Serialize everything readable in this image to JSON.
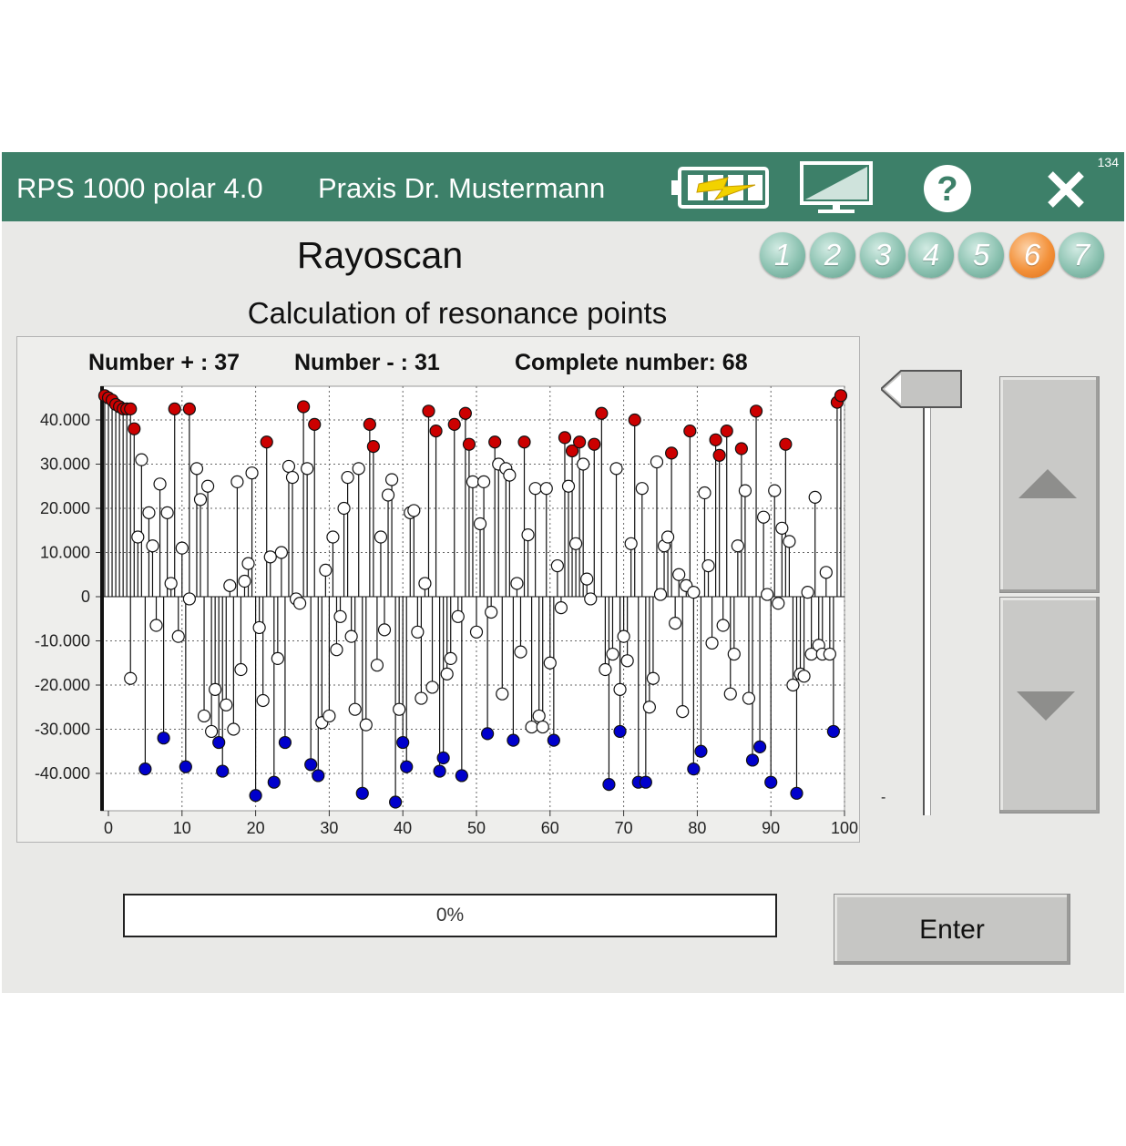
{
  "titlebar": {
    "app_name": "RPS 1000 polar 4.0",
    "practice": "Praxis Dr. Mustermann",
    "corner_number": "134",
    "color": "#3d8069",
    "icons": [
      "battery-charging-icon",
      "display-icon",
      "help-icon",
      "close-icon"
    ]
  },
  "page": {
    "title": "Rayoscan",
    "subtitle": "Calculation of resonance points"
  },
  "steps": {
    "items": [
      "1",
      "2",
      "3",
      "4",
      "5",
      "6",
      "7"
    ],
    "active": "6",
    "active_color": "#f3913a",
    "inactive_color": "#8cc2b1"
  },
  "stats": {
    "plus": "Number + : 37",
    "minus": "Number - : 31",
    "total": "Complete number: 68"
  },
  "slider": {
    "min_label": "-"
  },
  "progress": {
    "value": 0,
    "label": "0%"
  },
  "enter_button": {
    "label": "Enter"
  },
  "chart_data": {
    "type": "scatter",
    "style": "stem",
    "xlim": [
      0,
      100
    ],
    "ylim": [
      -50000,
      50000
    ],
    "x_ticks": [
      "0",
      "10",
      "20",
      "30",
      "40",
      "50",
      "60",
      "70",
      "80",
      "90",
      "100"
    ],
    "y_ticks": [
      "40.000",
      "30.000",
      "20.000",
      "10.000",
      "0",
      "-10.000",
      "-20.000",
      "-30.000",
      "-40.000"
    ],
    "y_tick_values": [
      40000,
      30000,
      20000,
      10000,
      0,
      -10000,
      -20000,
      -30000,
      -40000
    ],
    "grid": true,
    "colors": {
      "positive": "#cc0000",
      "neutral": "#ffffff",
      "negative": "#0000cc"
    },
    "series": [
      {
        "values": [
          [
            -0.5,
            45500,
            "pos"
          ],
          [
            0,
            45000,
            "pos"
          ],
          [
            0.5,
            44500,
            "pos"
          ],
          [
            1,
            43500,
            "pos"
          ],
          [
            1.5,
            43000,
            "pos"
          ],
          [
            2,
            42500,
            "pos"
          ],
          [
            2.5,
            42500,
            "pos"
          ],
          [
            3,
            42500,
            "pos"
          ],
          [
            3.5,
            38000,
            "pos"
          ],
          [
            9,
            42500,
            "pos"
          ],
          [
            11,
            42500,
            "pos"
          ],
          [
            21.5,
            35000,
            "pos"
          ],
          [
            26.5,
            43000,
            "pos"
          ],
          [
            28,
            39000,
            "pos"
          ],
          [
            35.5,
            39000,
            "pos"
          ],
          [
            36,
            34000,
            "pos"
          ],
          [
            43.5,
            42000,
            "pos"
          ],
          [
            44.5,
            37500,
            "pos"
          ],
          [
            47,
            39000,
            "pos"
          ],
          [
            48.5,
            41500,
            "pos"
          ],
          [
            49,
            34500,
            "pos"
          ],
          [
            52.5,
            35000,
            "pos"
          ],
          [
            56.5,
            35000,
            "pos"
          ],
          [
            62,
            36000,
            "pos"
          ],
          [
            63,
            33000,
            "pos"
          ],
          [
            64,
            35000,
            "pos"
          ],
          [
            66,
            34500,
            "pos"
          ],
          [
            67,
            41500,
            "pos"
          ],
          [
            71.5,
            40000,
            "pos"
          ],
          [
            76.5,
            32500,
            "pos"
          ],
          [
            79,
            37500,
            "pos"
          ],
          [
            82.5,
            35500,
            "pos"
          ],
          [
            83,
            32000,
            "pos"
          ],
          [
            84,
            37500,
            "pos"
          ],
          [
            86,
            33500,
            "pos"
          ],
          [
            88,
            42000,
            "pos"
          ],
          [
            92,
            34500,
            "pos"
          ],
          [
            99,
            44000,
            "pos"
          ],
          [
            99.5,
            45500,
            "pos"
          ],
          [
            5,
            -39000,
            "neg"
          ],
          [
            7.5,
            -32000,
            "neg"
          ],
          [
            10.5,
            -38500,
            "neg"
          ],
          [
            15,
            -33000,
            "neg"
          ],
          [
            15.5,
            -39500,
            "neg"
          ],
          [
            20,
            -45000,
            "neg"
          ],
          [
            22.5,
            -42000,
            "neg"
          ],
          [
            24,
            -33000,
            "neg"
          ],
          [
            27.5,
            -38000,
            "neg"
          ],
          [
            28.5,
            -40500,
            "neg"
          ],
          [
            34.5,
            -44500,
            "neg"
          ],
          [
            39,
            -46500,
            "neg"
          ],
          [
            40,
            -33000,
            "neg"
          ],
          [
            40.5,
            -38500,
            "neg"
          ],
          [
            45,
            -39500,
            "neg"
          ],
          [
            45.5,
            -36500,
            "neg"
          ],
          [
            48,
            -40500,
            "neg"
          ],
          [
            51.5,
            -31000,
            "neg"
          ],
          [
            55,
            -32500,
            "neg"
          ],
          [
            60.5,
            -32500,
            "neg"
          ],
          [
            68,
            -42500,
            "neg"
          ],
          [
            69.5,
            -30500,
            "neg"
          ],
          [
            72,
            -42000,
            "neg"
          ],
          [
            73,
            -42000,
            "neg"
          ],
          [
            79.5,
            -39000,
            "neg"
          ],
          [
            80.5,
            -35000,
            "neg"
          ],
          [
            87.5,
            -37000,
            "neg"
          ],
          [
            88.5,
            -34000,
            "neg"
          ],
          [
            90,
            -42000,
            "neg"
          ],
          [
            93.5,
            -44500,
            "neg"
          ],
          [
            98.5,
            -30500,
            "neg"
          ],
          [
            3,
            -18500,
            "neu"
          ],
          [
            4,
            13500,
            "neu"
          ],
          [
            4.5,
            31000,
            "neu"
          ],
          [
            5.5,
            19000,
            "neu"
          ],
          [
            6,
            11500,
            "neu"
          ],
          [
            6.5,
            -6500,
            "neu"
          ],
          [
            7,
            25500,
            "neu"
          ],
          [
            8,
            19000,
            "neu"
          ],
          [
            8.5,
            3000,
            "neu"
          ],
          [
            9.5,
            -9000,
            "neu"
          ],
          [
            10,
            11000,
            "neu"
          ],
          [
            11,
            -500,
            "neu"
          ],
          [
            12,
            29000,
            "neu"
          ],
          [
            12.5,
            22000,
            "neu"
          ],
          [
            13,
            -27000,
            "neu"
          ],
          [
            13.5,
            25000,
            "neu"
          ],
          [
            14,
            -30500,
            "neu"
          ],
          [
            14.5,
            -21000,
            "neu"
          ],
          [
            16,
            -24500,
            "neu"
          ],
          [
            16.5,
            2500,
            "neu"
          ],
          [
            17,
            -30000,
            "neu"
          ],
          [
            17.5,
            26000,
            "neu"
          ],
          [
            18,
            -16500,
            "neu"
          ],
          [
            18.5,
            3500,
            "neu"
          ],
          [
            19,
            7500,
            "neu"
          ],
          [
            19.5,
            28000,
            "neu"
          ],
          [
            20.5,
            -7000,
            "neu"
          ],
          [
            21,
            -23500,
            "neu"
          ],
          [
            22,
            9000,
            "neu"
          ],
          [
            23,
            -14000,
            "neu"
          ],
          [
            23.5,
            10000,
            "neu"
          ],
          [
            24.5,
            29500,
            "neu"
          ],
          [
            25,
            27000,
            "neu"
          ],
          [
            25.5,
            -500,
            "neu"
          ],
          [
            26,
            -1500,
            "neu"
          ],
          [
            27,
            29000,
            "neu"
          ],
          [
            29,
            -28500,
            "neu"
          ],
          [
            29.5,
            6000,
            "neu"
          ],
          [
            30,
            -27000,
            "neu"
          ],
          [
            30.5,
            13500,
            "neu"
          ],
          [
            31,
            -12000,
            "neu"
          ],
          [
            31.5,
            -4500,
            "neu"
          ],
          [
            32,
            20000,
            "neu"
          ],
          [
            32.5,
            27000,
            "neu"
          ],
          [
            33,
            -9000,
            "neu"
          ],
          [
            33.5,
            -25500,
            "neu"
          ],
          [
            34,
            29000,
            "neu"
          ],
          [
            35,
            -29000,
            "neu"
          ],
          [
            36.5,
            -15500,
            "neu"
          ],
          [
            37,
            13500,
            "neu"
          ],
          [
            37.5,
            -7500,
            "neu"
          ],
          [
            38,
            23000,
            "neu"
          ],
          [
            38.5,
            26500,
            "neu"
          ],
          [
            39.5,
            -25500,
            "neu"
          ],
          [
            41,
            19000,
            "neu"
          ],
          [
            41.5,
            19500,
            "neu"
          ],
          [
            42,
            -8000,
            "neu"
          ],
          [
            42.5,
            -23000,
            "neu"
          ],
          [
            43,
            3000,
            "neu"
          ],
          [
            44,
            -20500,
            "neu"
          ],
          [
            46,
            -17500,
            "neu"
          ],
          [
            46.5,
            -14000,
            "neu"
          ],
          [
            47.5,
            -4500,
            "neu"
          ],
          [
            49.5,
            26000,
            "neu"
          ],
          [
            50,
            -8000,
            "neu"
          ],
          [
            50.5,
            16500,
            "neu"
          ],
          [
            51,
            26000,
            "neu"
          ],
          [
            52,
            -3500,
            "neu"
          ],
          [
            53,
            30000,
            "neu"
          ],
          [
            53.5,
            -22000,
            "neu"
          ],
          [
            54,
            29000,
            "neu"
          ],
          [
            54.5,
            27500,
            "neu"
          ],
          [
            55.5,
            3000,
            "neu"
          ],
          [
            56,
            -12500,
            "neu"
          ],
          [
            57,
            14000,
            "neu"
          ],
          [
            57.5,
            -29500,
            "neu"
          ],
          [
            58,
            24500,
            "neu"
          ],
          [
            58.5,
            -27000,
            "neu"
          ],
          [
            59,
            -29500,
            "neu"
          ],
          [
            59.5,
            24500,
            "neu"
          ],
          [
            60,
            -15000,
            "neu"
          ],
          [
            61,
            7000,
            "neu"
          ],
          [
            61.5,
            -2500,
            "neu"
          ],
          [
            62.5,
            25000,
            "neu"
          ],
          [
            63.5,
            12000,
            "neu"
          ],
          [
            64.5,
            30000,
            "neu"
          ],
          [
            65,
            4000,
            "neu"
          ],
          [
            65.5,
            -500,
            "neu"
          ],
          [
            67.5,
            -16500,
            "neu"
          ],
          [
            68.5,
            -13000,
            "neu"
          ],
          [
            69,
            29000,
            "neu"
          ],
          [
            69.5,
            -21000,
            "neu"
          ],
          [
            70,
            -9000,
            "neu"
          ],
          [
            70.5,
            -14500,
            "neu"
          ],
          [
            71,
            12000,
            "neu"
          ],
          [
            72.5,
            24500,
            "neu"
          ],
          [
            73.5,
            -25000,
            "neu"
          ],
          [
            74,
            -18500,
            "neu"
          ],
          [
            74.5,
            30500,
            "neu"
          ],
          [
            75,
            500,
            "neu"
          ],
          [
            75.5,
            11500,
            "neu"
          ],
          [
            76,
            13500,
            "neu"
          ],
          [
            77,
            -6000,
            "neu"
          ],
          [
            77.5,
            5000,
            "neu"
          ],
          [
            78,
            -26000,
            "neu"
          ],
          [
            78.5,
            2500,
            "neu"
          ],
          [
            79.5,
            1000,
            "neu"
          ],
          [
            81,
            23500,
            "neu"
          ],
          [
            81.5,
            7000,
            "neu"
          ],
          [
            82,
            -10500,
            "neu"
          ],
          [
            83.5,
            -6500,
            "neu"
          ],
          [
            84.5,
            -22000,
            "neu"
          ],
          [
            85,
            -13000,
            "neu"
          ],
          [
            85.5,
            11500,
            "neu"
          ],
          [
            86.5,
            24000,
            "neu"
          ],
          [
            87,
            -23000,
            "neu"
          ],
          [
            89,
            18000,
            "neu"
          ],
          [
            89.5,
            500,
            "neu"
          ],
          [
            90.5,
            24000,
            "neu"
          ],
          [
            91,
            -1500,
            "neu"
          ],
          [
            91.5,
            15500,
            "neu"
          ],
          [
            92.5,
            12500,
            "neu"
          ],
          [
            93,
            -20000,
            "neu"
          ],
          [
            94,
            -17500,
            "neu"
          ],
          [
            94.5,
            -18000,
            "neu"
          ],
          [
            95,
            1000,
            "neu"
          ],
          [
            95.5,
            -13000,
            "neu"
          ],
          [
            96,
            22500,
            "neu"
          ],
          [
            96.5,
            -11000,
            "neu"
          ],
          [
            97,
            -13000,
            "neu"
          ],
          [
            97.5,
            5500,
            "neu"
          ],
          [
            98,
            -13000,
            "neu"
          ]
        ]
      }
    ]
  }
}
